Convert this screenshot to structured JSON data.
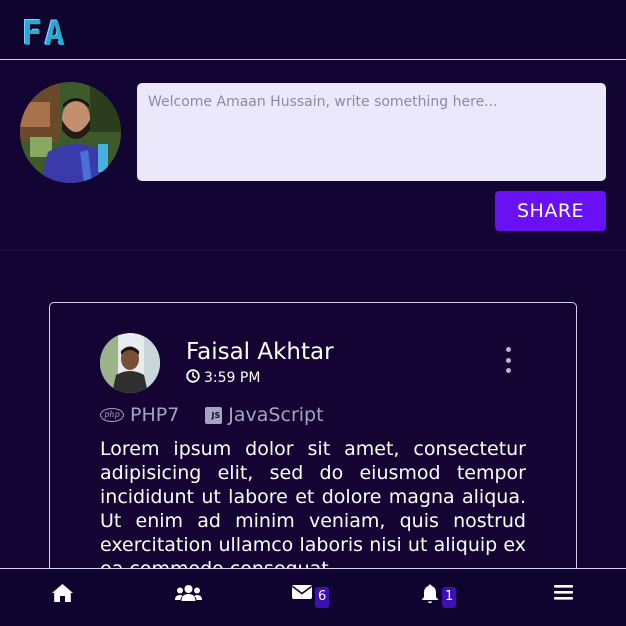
{
  "header": {
    "logo_text": "FA"
  },
  "composer": {
    "placeholder": "Welcome Amaan Hussain, write something here...",
    "share_label": "SHARE"
  },
  "post": {
    "author": "Faisal Akhtar",
    "time": "3:59 PM",
    "tags": [
      {
        "label": "PHP7",
        "icon": "php-icon"
      },
      {
        "label": "JavaScript",
        "icon": "javascript-icon"
      }
    ],
    "body": "Lorem ipsum dolor sit amet, consectetur adipisicing elit, sed do eiusmod tempor incididunt ut labore et dolore magna aliqua. Ut enim ad minim veniam, quis nostrud exercitation ullamco laboris nisi ut aliquip ex ea commodo consequat."
  },
  "nav": {
    "items": [
      {
        "icon": "home-icon"
      },
      {
        "icon": "users-icon"
      },
      {
        "icon": "envelope-icon",
        "badge": "6"
      },
      {
        "icon": "bell-icon",
        "badge": "1"
      },
      {
        "icon": "hamburger-menu-icon"
      }
    ]
  },
  "colors": {
    "background": "#120433",
    "accent": "#6a10f5",
    "badge": "#3d0fb5",
    "input_background": "#ece8fb"
  }
}
